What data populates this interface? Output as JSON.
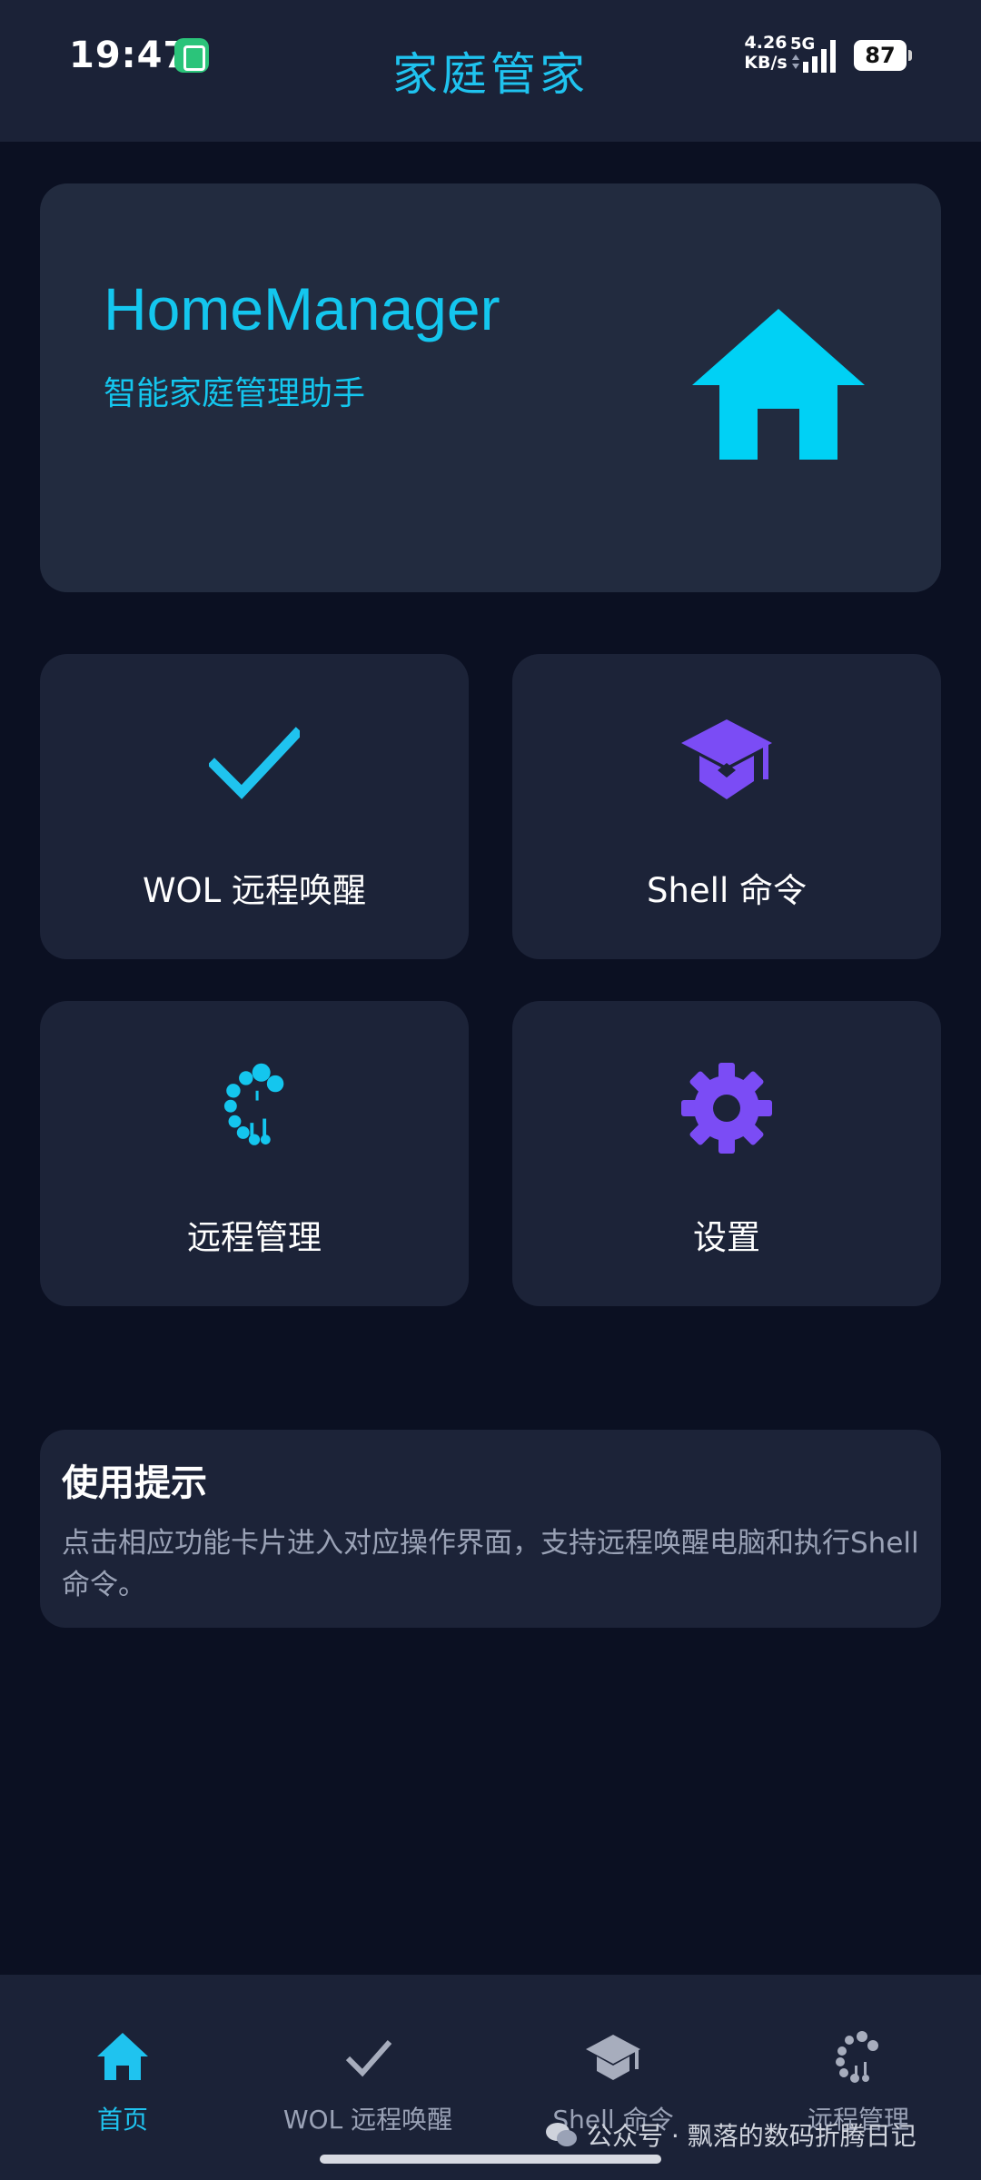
{
  "status_bar": {
    "time": "19:47",
    "net_speed_value": "4.26",
    "net_speed_unit": "KB/s",
    "network_type": "5G",
    "battery": "87"
  },
  "header": {
    "title": "家庭管家"
  },
  "hero": {
    "title": "HomeManager",
    "subtitle": "智能家庭管理助手",
    "icon": "home-icon"
  },
  "features": [
    {
      "label": "WOL 远程唤醒",
      "icon": "check-icon",
      "color": "#1fc3ef"
    },
    {
      "label": "Shell 命令",
      "icon": "graduation-cap-icon",
      "color": "#7b4cf5"
    },
    {
      "label": "远程管理",
      "icon": "remote-manage-icon",
      "color": "#14c6ee"
    },
    {
      "label": "设置",
      "icon": "gear-icon",
      "color": "#7b4cf5"
    }
  ],
  "tips": {
    "title": "使用提示",
    "text": "点击相应功能卡片进入对应操作界面，支持远程唤醒电脑和执行Shell命令。"
  },
  "bottom_nav": {
    "items": [
      {
        "label": "首页",
        "icon": "home-icon",
        "active": true
      },
      {
        "label": "WOL 远程唤醒",
        "icon": "check-icon",
        "active": false
      },
      {
        "label": "Shell 命令",
        "icon": "graduation-cap-icon",
        "active": false
      },
      {
        "label": "远程管理",
        "icon": "remote-manage-icon",
        "active": false
      }
    ]
  },
  "watermark": {
    "text": "公众号 · 飘落的数码折腾日记"
  },
  "colors": {
    "accent": "#1fc3ef",
    "purple": "#7b4cf5",
    "background": "#0b1022",
    "card": "#1c2338"
  }
}
